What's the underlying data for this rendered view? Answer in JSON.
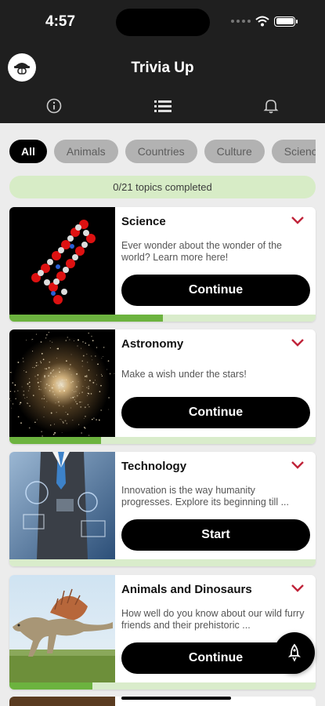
{
  "status_bar": {
    "time": "4:57"
  },
  "header": {
    "title": "Trivia Up",
    "nav_icons": [
      "info-icon",
      "list-icon",
      "bell-icon"
    ]
  },
  "filters": [
    "All",
    "Animals",
    "Countries",
    "Culture",
    "Science"
  ],
  "progress_text": "0/21 topics completed",
  "topics": [
    {
      "title": "Science",
      "description": "Ever wonder about the wonder of the world? Learn more here!",
      "button": "Continue",
      "progress": 0.5
    },
    {
      "title": "Astronomy",
      "description": "Make a wish under the stars!",
      "button": "Continue",
      "progress": 0.3
    },
    {
      "title": "Technology",
      "description": "Innovation is the way humanity progresses. Explore its beginning till ...",
      "button": "Start",
      "progress": 0
    },
    {
      "title": "Animals and Dinosaurs",
      "description": "How well do you know about our wild furry friends and their prehistoric ...",
      "button": "Continue",
      "progress": 0.27
    }
  ],
  "colors": {
    "accent_red": "#c0243a",
    "progress_green": "#6cb33f",
    "progress_track": "#d9eccb",
    "banner_green": "#d7ecc6"
  }
}
